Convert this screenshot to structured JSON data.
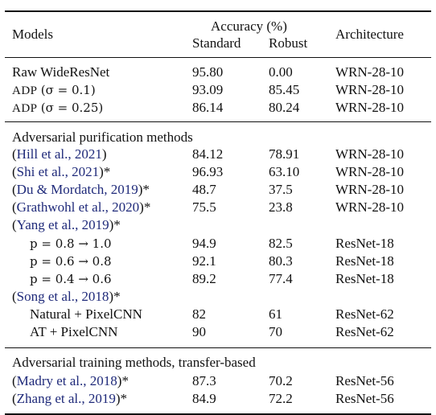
{
  "header": {
    "models": "Models",
    "accuracy": "Accuracy (%)",
    "standard": "Standard",
    "robust": "Robust",
    "architecture": "Architecture"
  },
  "sections": [
    {
      "title": "",
      "rows": [
        {
          "model": {
            "text": "Raw WideResNet"
          },
          "standard": "95.80",
          "robust": "0.00",
          "arch": "WRN-28-10"
        },
        {
          "model": {
            "sc": "ADP",
            "math": "(σ = 0.1)"
          },
          "standard": "93.09",
          "robust": "85.45",
          "arch": "WRN-28-10"
        },
        {
          "model": {
            "sc": "ADP",
            "math": "(σ = 0.25)"
          },
          "standard": "86.14",
          "robust": "80.24",
          "arch": "WRN-28-10"
        }
      ]
    },
    {
      "title": "Adversarial purification methods",
      "rows": [
        {
          "model": {
            "open": "(",
            "cite": "Hill et al., 2021",
            "close": ")"
          },
          "standard": "84.12",
          "robust": "78.91",
          "arch": "WRN-28-10"
        },
        {
          "model": {
            "open": "(",
            "cite": "Shi et al., 2021",
            "close": ")*"
          },
          "standard": "96.93",
          "robust": "63.10",
          "arch": "WRN-28-10"
        },
        {
          "model": {
            "open": "(",
            "cite": "Du & Mordatch, 2019",
            "close": ")*"
          },
          "standard": "48.7",
          "robust": "37.5",
          "arch": "WRN-28-10"
        },
        {
          "model": {
            "open": "(",
            "cite": "Grathwohl et al., 2020",
            "close": ")*"
          },
          "standard": "75.5",
          "robust": "23.8",
          "arch": "WRN-28-10"
        },
        {
          "model": {
            "open": "(",
            "cite": "Yang et al., 2019",
            "close": ")*"
          },
          "standard": "",
          "robust": "",
          "arch": ""
        },
        {
          "model": {
            "math": "p = 0.8 → 1.0",
            "indent": true
          },
          "standard": "94.9",
          "robust": "82.5",
          "arch": "ResNet-18"
        },
        {
          "model": {
            "math": "p = 0.6 → 0.8",
            "indent": true
          },
          "standard": "92.1",
          "robust": "80.3",
          "arch": "ResNet-18"
        },
        {
          "model": {
            "math": "p = 0.4 → 0.6",
            "indent": true
          },
          "standard": "89.2",
          "robust": "77.4",
          "arch": "ResNet-18"
        },
        {
          "model": {
            "open": "(",
            "cite": "Song et al., 2018",
            "close": ")*"
          },
          "standard": "",
          "robust": "",
          "arch": ""
        },
        {
          "model": {
            "text": "Natural + PixelCNN",
            "indent": true
          },
          "standard": "82",
          "robust": "61",
          "arch": "ResNet-62"
        },
        {
          "model": {
            "text": "AT + PixelCNN",
            "indent": true
          },
          "standard": "90",
          "robust": "70",
          "arch": "ResNet-62"
        }
      ]
    },
    {
      "title": "Adversarial training methods, transfer-based",
      "rows": [
        {
          "model": {
            "open": "(",
            "cite": "Madry et al., 2018",
            "close": ")*"
          },
          "standard": "87.3",
          "robust": "70.2",
          "arch": "ResNet-56"
        },
        {
          "model": {
            "open": "(",
            "cite": "Zhang et al., 2019",
            "close": ")*"
          },
          "standard": "84.9",
          "robust": "72.2",
          "arch": "ResNet-56"
        }
      ]
    }
  ],
  "colors": {
    "citation": "#1f2a7a",
    "text": "#111111"
  }
}
